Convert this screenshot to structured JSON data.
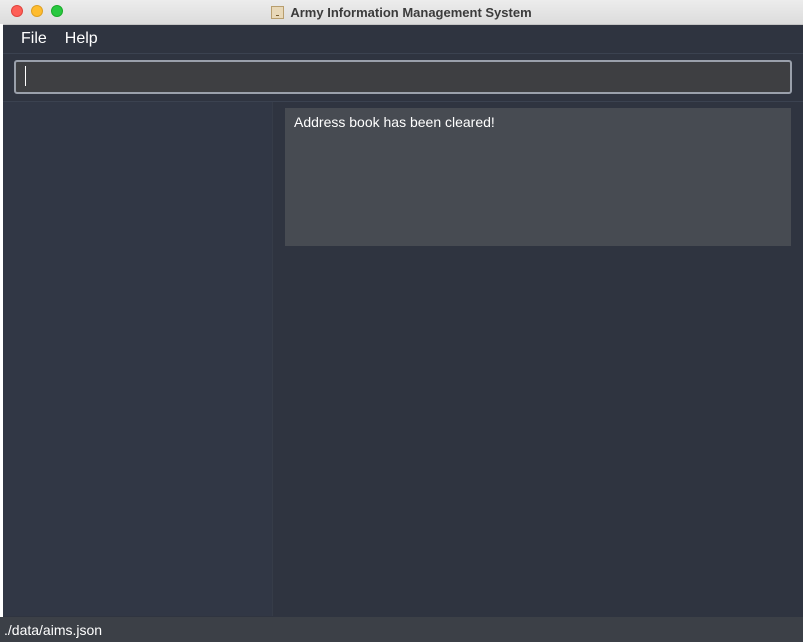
{
  "window": {
    "title": "Army Information Management System"
  },
  "menu": {
    "items": [
      {
        "label": "File"
      },
      {
        "label": "Help"
      }
    ]
  },
  "command": {
    "value": "",
    "placeholder": ""
  },
  "result": {
    "message": "Address book has been cleared!"
  },
  "status": {
    "path": "./data/aims.json"
  },
  "colors": {
    "background": "#2f3440",
    "list_panel": "#313745",
    "result_box": "#474b52",
    "status_bar": "#3c4047",
    "command_border": "#9aa0ab"
  }
}
